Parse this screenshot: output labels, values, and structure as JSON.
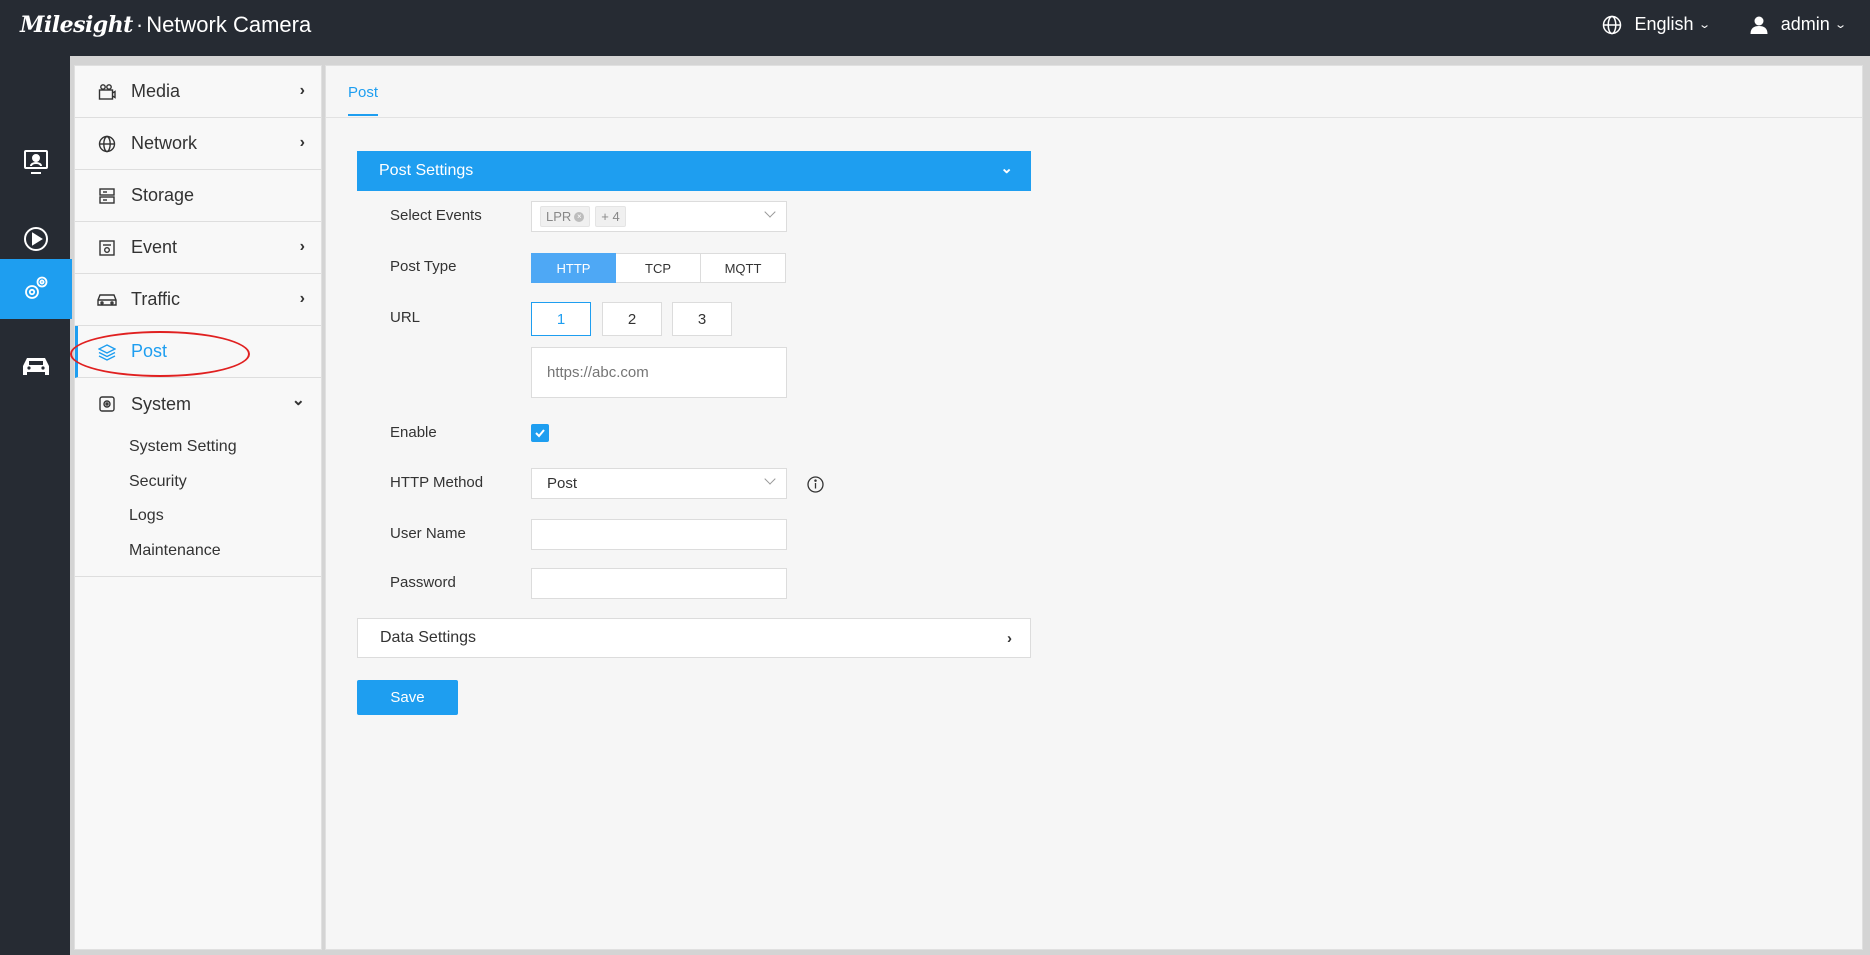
{
  "header": {
    "brand": "Milesight",
    "product": "Network Camera",
    "language": "English",
    "user": "admin"
  },
  "rail": {
    "items": [
      {
        "icon": "live-view-icon"
      },
      {
        "icon": "playback-icon"
      },
      {
        "icon": "settings-icon",
        "active": true
      },
      {
        "icon": "vehicle-icon"
      }
    ]
  },
  "menu": {
    "items": [
      {
        "label": "Media",
        "icon": "media-icon",
        "chevron": "›"
      },
      {
        "label": "Network",
        "icon": "globe-icon",
        "chevron": "›"
      },
      {
        "label": "Storage",
        "icon": "storage-icon"
      },
      {
        "label": "Event",
        "icon": "event-icon",
        "chevron": "›"
      },
      {
        "label": "Traffic",
        "icon": "car-icon",
        "chevron": "›"
      },
      {
        "label": "Post",
        "icon": "layers-icon",
        "active": true
      },
      {
        "label": "System",
        "icon": "system-icon",
        "chevron": "⌄"
      }
    ],
    "system_sub": [
      "System Setting",
      "Security",
      "Logs",
      "Maintenance"
    ]
  },
  "content": {
    "tab": "Post",
    "post_settings": {
      "title": "Post Settings",
      "chevron": "⌄",
      "select_events_label": "Select Events",
      "event_tag": "LPR",
      "event_more": "+ 4",
      "post_type_label": "Post Type",
      "post_types": [
        "HTTP",
        "TCP",
        "MQTT"
      ],
      "post_type_selected": "HTTP",
      "url_label": "URL",
      "url_buttons": [
        "1",
        "2",
        "3"
      ],
      "url_selected": "1",
      "url_placeholder": "https://abc.com",
      "enable_label": "Enable",
      "enable_checked": true,
      "http_method_label": "HTTP Method",
      "http_method_value": "Post",
      "user_name_label": "User Name",
      "user_name_value": "",
      "password_label": "Password",
      "password_value": ""
    },
    "data_settings": {
      "title": "Data Settings",
      "chevron": "›"
    },
    "save_label": "Save"
  },
  "colors": {
    "accent": "#1e9ef0",
    "header_bg": "#262b33",
    "annotation": "#e02020"
  }
}
